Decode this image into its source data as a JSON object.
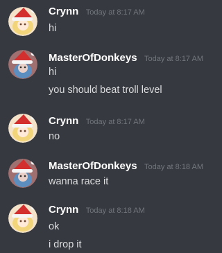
{
  "messages": [
    {
      "author": "Crynn",
      "time": "Today at 8:17 AM",
      "avatar": "crynn-avatar",
      "lines": [
        "hi"
      ]
    },
    {
      "author": "MasterOfDonkeys",
      "time": "Today at 8:17 AM",
      "avatar": "masterofdonkeys-avatar",
      "lines": [
        "hi",
        "you should beat troll level"
      ]
    },
    {
      "author": "Crynn",
      "time": "Today at 8:17 AM",
      "avatar": "crynn-avatar",
      "lines": [
        "no"
      ]
    },
    {
      "author": "MasterOfDonkeys",
      "time": "Today at 8:18 AM",
      "avatar": "masterofdonkeys-avatar",
      "lines": [
        "wanna race it"
      ]
    },
    {
      "author": "Crynn",
      "time": "Today at 8:18 AM",
      "avatar": "crynn-avatar",
      "lines": [
        "ok",
        "i drop it"
      ]
    }
  ],
  "colors": {
    "background": "#36393f",
    "username": "#ffffff",
    "timestamp": "#72767d",
    "message_text": "#dcddde",
    "santa_hat_red": "#d32f2f",
    "santa_hat_white": "#f5f5f5"
  }
}
